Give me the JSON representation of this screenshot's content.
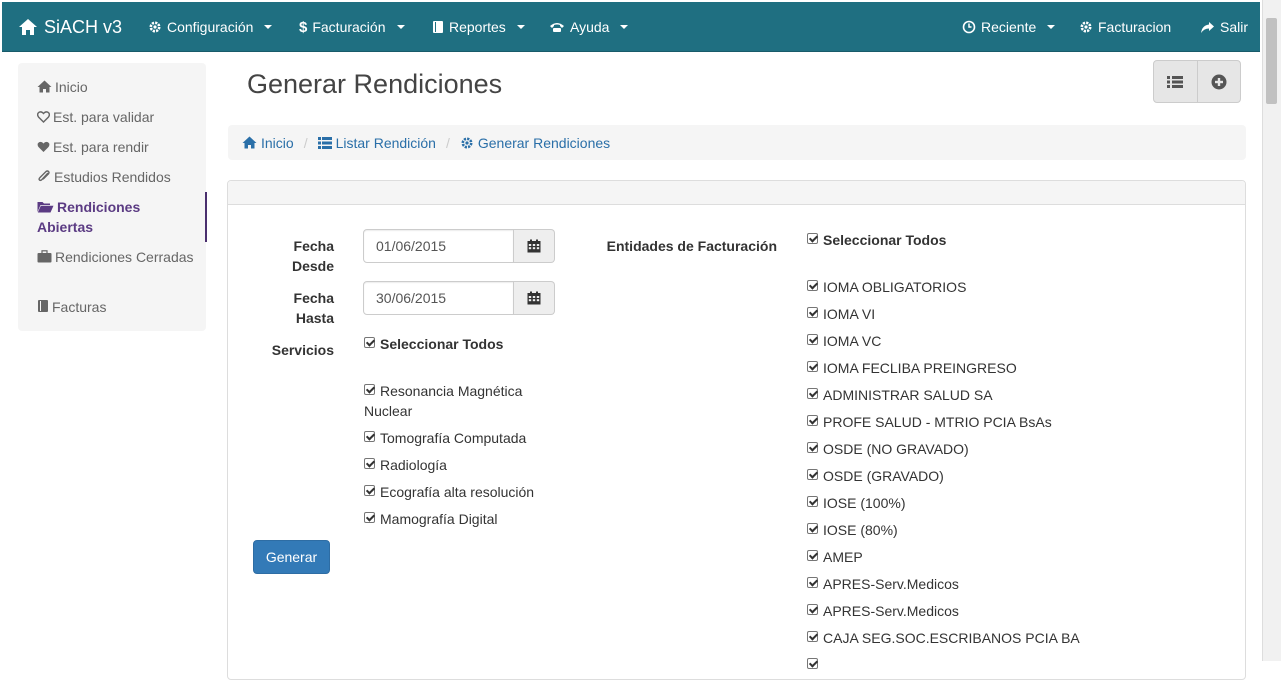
{
  "navbar": {
    "brand": "SiACH v3",
    "menus": [
      {
        "label": "Configuración",
        "icon": "gear-icon"
      },
      {
        "label": "Facturación",
        "icon": "dollar-icon"
      },
      {
        "label": "Reportes",
        "icon": "book-icon"
      },
      {
        "label": "Ayuda",
        "icon": "phone-icon"
      }
    ],
    "right": [
      {
        "label": "Reciente",
        "icon": "clock-icon"
      },
      {
        "label": "Facturacion",
        "icon": "gear-icon"
      },
      {
        "label": "Salir",
        "icon": "share-icon"
      }
    ]
  },
  "sidebar": {
    "items": [
      {
        "label": "Inicio",
        "icon": "home-icon"
      },
      {
        "label": "Est. para validar",
        "icon": "heart-outline-icon"
      },
      {
        "label": "Est. para rendir",
        "icon": "heart-icon"
      },
      {
        "label": "Estudios Rendidos",
        "icon": "paperclip-icon"
      },
      {
        "label": "Rendiciones Abiertas",
        "icon": "folder-open-icon"
      },
      {
        "label": "Rendiciones Cerradas",
        "icon": "briefcase-icon"
      },
      {
        "label": "Facturas",
        "icon": "book-icon"
      }
    ]
  },
  "page": {
    "title": "Generar Rendiciones"
  },
  "breadcrumb": [
    {
      "label": "Inicio",
      "icon": "home-icon"
    },
    {
      "label": "Listar Rendición",
      "icon": "list-icon"
    },
    {
      "label": "Generar Rendiciones",
      "icon": "gear-icon"
    }
  ],
  "form": {
    "fecha_desde_label_1": "Fecha",
    "fecha_desde_label_2": "Desde",
    "fecha_desde_value": "01/06/2015",
    "fecha_hasta_label_1": "Fecha",
    "fecha_hasta_label_2": "Hasta",
    "fecha_hasta_value": "30/06/2015",
    "servicios_label": "Servicios",
    "seleccionar_todos": "Seleccionar Todos",
    "servicios": [
      "Resonancia Magnética",
      "Nuclear",
      "Tomografía Computada",
      "Radiología",
      "Ecografía alta resolución",
      "Mamografía Digital"
    ],
    "entidades_label": "Entidades de Facturación",
    "entidades": [
      "IOMA OBLIGATORIOS",
      "IOMA VI",
      "IOMA VC",
      "IOMA FECLIBA PREINGRESO",
      "ADMINISTRAR SALUD SA",
      "PROFE SALUD - MTRIO PCIA BsAs",
      "OSDE (NO GRAVADO)",
      "OSDE (GRAVADO)",
      "IOSE (100%)",
      "IOSE (80%)",
      "AMEP",
      "APRES-Serv.Medicos",
      "APRES-Serv.Medicos",
      "CAJA SEG.SOC.ESCRIBANOS PCIA BA"
    ],
    "generar_label": "Generar"
  },
  "colors": {
    "navbar": "#1f6f81",
    "primary": "#337ab7",
    "link": "#2a6fa8",
    "active_sidebar": "#5b3b83"
  }
}
